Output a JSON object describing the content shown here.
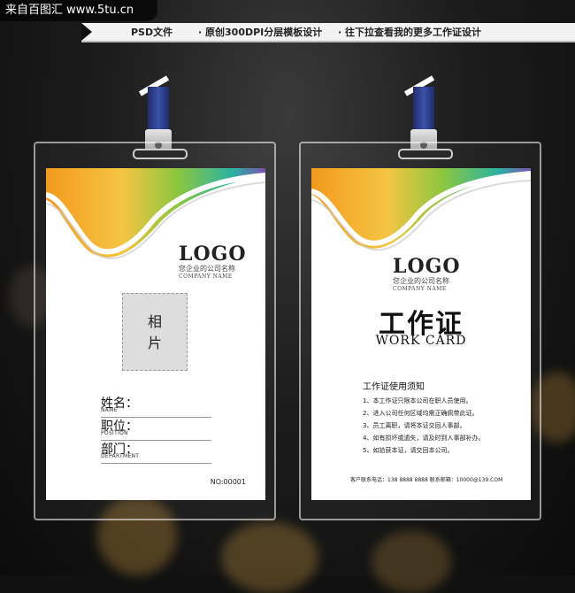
{
  "watermark": "来自百图汇  www.5tu.cn",
  "banner": {
    "items": [
      "PSD文件",
      "· 原创300DPI分层模板设计",
      "· 往下拉查看我的更多工作证设计"
    ]
  },
  "front": {
    "logo_word": "LOGO",
    "company_cn": "您企业的公司名称",
    "company_en": "COMPANY NAME",
    "photo_label": "相片",
    "fields": [
      {
        "label": "姓名：",
        "sub": "NAME"
      },
      {
        "label": "职位：",
        "sub": "POSITION"
      },
      {
        "label": "部门：",
        "sub": "DEPARTMENT"
      }
    ],
    "number": "NO:00001"
  },
  "back": {
    "logo_word": "LOGO",
    "company_cn": "您企业的公司名称",
    "company_en": "COMPANY NAME",
    "title_cn": "工作证",
    "title_en": "WORK CARD",
    "notice_title": "工作证使用须知",
    "rules": [
      "1、本工作证只限本公司在职人员使用。",
      "2、进入公司任何区域均需正确佩带此证。",
      "3、员工离职，请将本证交回人事部。",
      "4、如有损坏或遗失，请及时到人事部补办。",
      "5、如拾获本证，请交回本公司。"
    ],
    "contact": "客户联系电话：138 8888 8888      联系邮箱：10000@139.COM"
  },
  "colors": {
    "wave_orange": "#f39a1e",
    "wave_green": "#8cc63f",
    "wave_teal": "#2bb3a3",
    "wave_purple": "#7a4fb0",
    "strap": "#2b3f8f"
  }
}
